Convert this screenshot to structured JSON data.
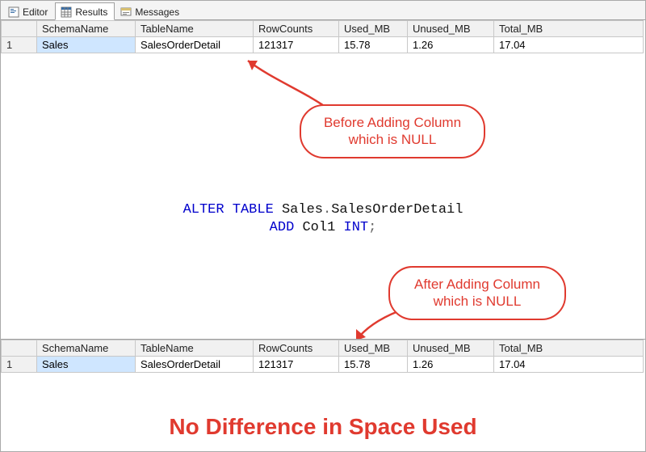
{
  "tabs": {
    "editor": "Editor",
    "results": "Results",
    "messages": "Messages"
  },
  "grid": {
    "headers": {
      "schema": "SchemaName",
      "table": "TableName",
      "rows": "RowCounts",
      "used": "Used_MB",
      "unused": "Unused_MB",
      "total": "Total_MB"
    },
    "before": {
      "rownum": "1",
      "schema": "Sales",
      "table": "SalesOrderDetail",
      "rows": "121317",
      "used": "15.78",
      "unused": "1.26",
      "total": "17.04"
    },
    "after": {
      "rownum": "1",
      "schema": "Sales",
      "table": "SalesOrderDetail",
      "rows": "121317",
      "used": "15.78",
      "unused": "1.26",
      "total": "17.04"
    }
  },
  "sql": {
    "kw_alter": "ALTER TABLE",
    "obj": "Sales",
    "dot": ".",
    "obj2": "SalesOrderDetail",
    "kw_add": "ADD",
    "col": "Col1",
    "type": "INT",
    "semi": ";"
  },
  "callouts": {
    "before_l1": "Before Adding Column",
    "before_l2": "which is NULL",
    "after_l1": "After Adding Column",
    "after_l2": "which is NULL"
  },
  "caption": "No Difference in Space Used"
}
